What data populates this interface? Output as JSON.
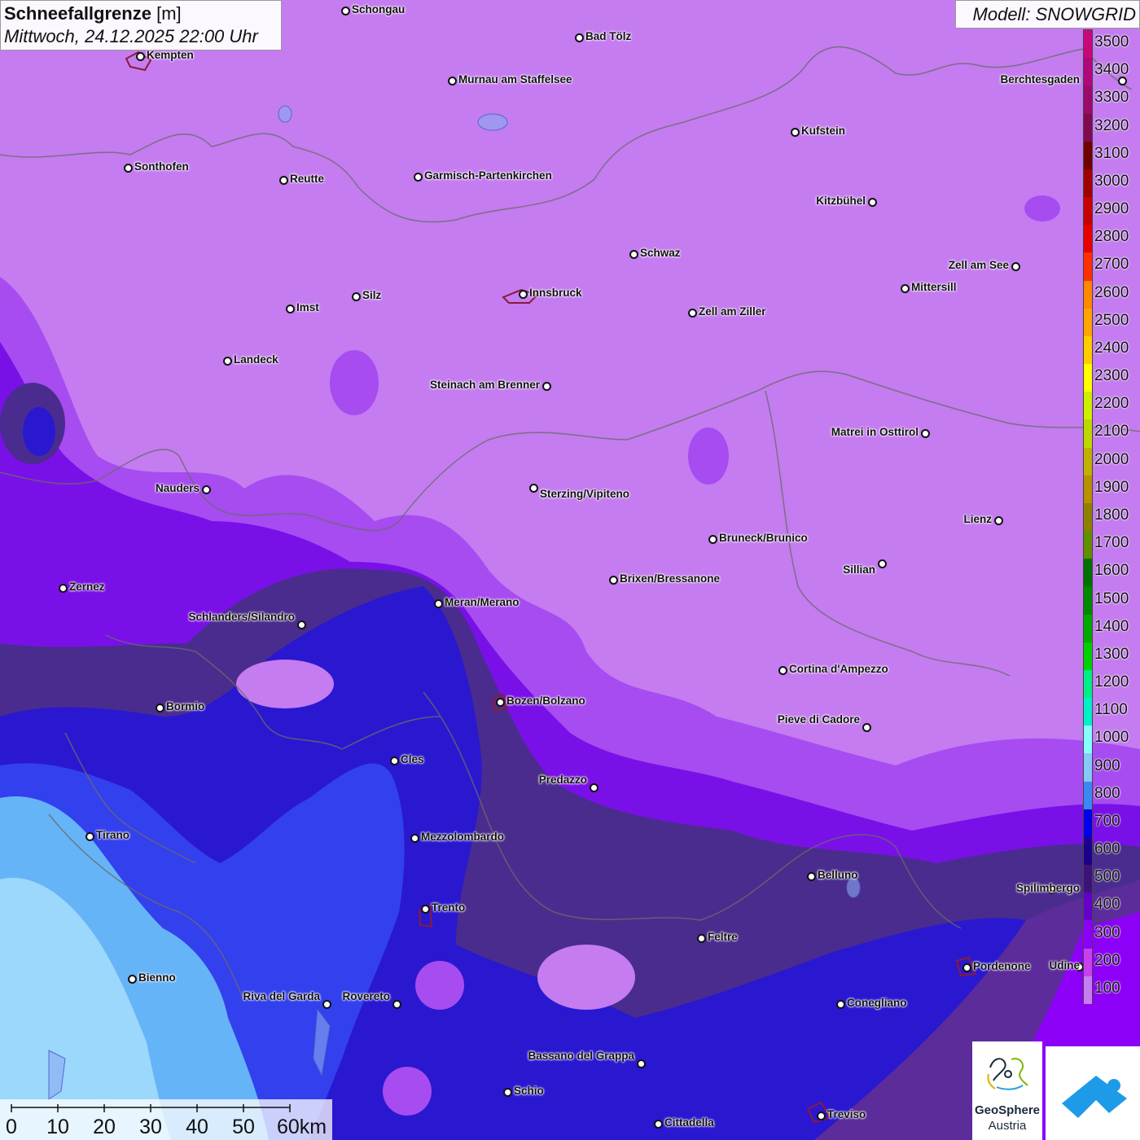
{
  "title": {
    "parameter": "Schneefallgrenze",
    "unit": "[m]",
    "datetime": "Mittwoch, 24.12.2025 22:00 Uhr"
  },
  "model": "Modell: SNOWGRID",
  "legend": {
    "labels": [
      "3500",
      "3400",
      "3300",
      "3200",
      "3100",
      "3000",
      "2900",
      "2800",
      "2700",
      "2600",
      "2500",
      "2400",
      "2300",
      "2200",
      "2100",
      "2000",
      "1900",
      "1800",
      "1700",
      "1600",
      "1500",
      "1400",
      "1300",
      "1200",
      "1100",
      "1000",
      "900",
      "800",
      "700",
      "600",
      "500",
      "400",
      "300",
      "200",
      "100"
    ],
    "colors": [
      "#c8087a",
      "#b0087a",
      "#9a0a6a",
      "#800a50",
      "#700000",
      "#a00000",
      "#c80000",
      "#e80000",
      "#ff3000",
      "#ff8800",
      "#ffa400",
      "#ffcc00",
      "#ffff00",
      "#ccf000",
      "#bcd800",
      "#c0b000",
      "#b89000",
      "#908000",
      "#609000",
      "#007000",
      "#008800",
      "#00a800",
      "#00d000",
      "#00ee88",
      "#00f0c8",
      "#88ffff",
      "#88c8f8",
      "#3c88f0",
      "#0000e8",
      "#1c008c",
      "#3c1478",
      "#6400c8",
      "#8c00f8",
      "#c840f0",
      "#c87cf4"
    ]
  },
  "cities": [
    {
      "name": "Schongau",
      "dot": [
        424,
        13
      ],
      "label_side": "right"
    },
    {
      "name": "Bad Tölz",
      "dot": [
        711,
        46
      ],
      "label_side": "right"
    },
    {
      "name": "Kempten",
      "dot": [
        172,
        69
      ],
      "label_side": "right"
    },
    {
      "name": "Murnau am Staffelsee",
      "dot": [
        555,
        99
      ],
      "label_side": "right"
    },
    {
      "name": "Berchtesgaden",
      "dot": [
        1378,
        99
      ],
      "label_side": "left"
    },
    {
      "name": "Kufstein",
      "dot": [
        976,
        162
      ],
      "label_side": "right"
    },
    {
      "name": "Sonthofen",
      "dot": [
        157,
        206
      ],
      "label_side": "right"
    },
    {
      "name": "Reutte",
      "dot": [
        348,
        221
      ],
      "label_side": "right"
    },
    {
      "name": "Garmisch-Partenkirchen",
      "dot": [
        513,
        217
      ],
      "label_side": "right"
    },
    {
      "name": "Kitzbühel",
      "dot": [
        1071,
        248
      ],
      "label_side": "left"
    },
    {
      "name": "Schwaz",
      "dot": [
        778,
        312
      ],
      "label_side": "right"
    },
    {
      "name": "Zell am See",
      "dot": [
        1247,
        327
      ],
      "label_side": "left"
    },
    {
      "name": "Innsbruck",
      "dot": [
        642,
        361
      ],
      "label_side": "right"
    },
    {
      "name": "Silz",
      "dot": [
        437,
        364
      ],
      "label_side": "right"
    },
    {
      "name": "Mittersill",
      "dot": [
        1111,
        354
      ],
      "label_side": "right"
    },
    {
      "name": "Imst",
      "dot": [
        356,
        379
      ],
      "label_side": "right"
    },
    {
      "name": "Zell am Ziller",
      "dot": [
        850,
        384
      ],
      "label_side": "right"
    },
    {
      "name": "Landeck",
      "dot": [
        279,
        443
      ],
      "label_side": "right"
    },
    {
      "name": "Steinach am Brenner",
      "dot": [
        671,
        474
      ],
      "label_side": "left"
    },
    {
      "name": "Matrei in Osttirol",
      "dot": [
        1136,
        532
      ],
      "label_side": "left"
    },
    {
      "name": "Nauders",
      "dot": [
        253,
        601
      ],
      "label_side": "left"
    },
    {
      "name": "Sterzing/Vipiteno",
      "dot": [
        655,
        599
      ],
      "label_side": "right-below"
    },
    {
      "name": "Lienz",
      "dot": [
        1226,
        639
      ],
      "label_side": "left"
    },
    {
      "name": "Bruneck/Brunico",
      "dot": [
        875,
        662
      ],
      "label_side": "right"
    },
    {
      "name": "Sillian",
      "dot": [
        1083,
        692
      ],
      "label_side": "left-below"
    },
    {
      "name": "Brixen/Bressanone",
      "dot": [
        753,
        712
      ],
      "label_side": "right"
    },
    {
      "name": "Zernez",
      "dot": [
        77,
        722
      ],
      "label_side": "right"
    },
    {
      "name": "Meran/Merano",
      "dot": [
        538,
        741
      ],
      "label_side": "right"
    },
    {
      "name": "Schlanders/Silandro",
      "dot": [
        370,
        767
      ],
      "label_side": "left-above"
    },
    {
      "name": "Cortina d'Ampezzo",
      "dot": [
        961,
        823
      ],
      "label_side": "right"
    },
    {
      "name": "Bozen/Bolzano",
      "dot": [
        614,
        862
      ],
      "label_side": "right"
    },
    {
      "name": "Bormio",
      "dot": [
        196,
        869
      ],
      "label_side": "right"
    },
    {
      "name": "Pieve di Cadore",
      "dot": [
        1064,
        893
      ],
      "label_side": "left-above"
    },
    {
      "name": "Cles",
      "dot": [
        484,
        934
      ],
      "label_side": "right"
    },
    {
      "name": "Predazzo",
      "dot": [
        729,
        967
      ],
      "label_side": "left-above"
    },
    {
      "name": "Tirano",
      "dot": [
        110,
        1027
      ],
      "label_side": "right"
    },
    {
      "name": "Mezzolombardo",
      "dot": [
        509,
        1029
      ],
      "label_side": "right"
    },
    {
      "name": "Belluno",
      "dot": [
        996,
        1076
      ],
      "label_side": "right"
    },
    {
      "name": "Spilimbergo",
      "dot": [
        1291,
        1092
      ],
      "label_side": "right"
    },
    {
      "name": "Trento",
      "dot": [
        522,
        1116
      ],
      "label_side": "right"
    },
    {
      "name": "Feltre",
      "dot": [
        861,
        1152
      ],
      "label_side": "right"
    },
    {
      "name": "Pordenone",
      "dot": [
        1187,
        1188
      ],
      "label_side": "right"
    },
    {
      "name": "Udine",
      "dot": [
        1325,
        1187
      ],
      "label_side": "right"
    },
    {
      "name": "Bienno",
      "dot": [
        162,
        1202
      ],
      "label_side": "right"
    },
    {
      "name": "Riva del Garda",
      "dot": [
        401,
        1233
      ],
      "label_side": "left-above"
    },
    {
      "name": "Rovereto",
      "dot": [
        487,
        1233
      ],
      "label_side": "left-above"
    },
    {
      "name": "Conegliano",
      "dot": [
        1032,
        1233
      ],
      "label_side": "right"
    },
    {
      "name": "Bassano del Grappa",
      "dot": [
        787,
        1306
      ],
      "label_side": "left-above"
    },
    {
      "name": "Schio",
      "dot": [
        623,
        1341
      ],
      "label_side": "right"
    },
    {
      "name": "Treviso",
      "dot": [
        1008,
        1370
      ],
      "label_side": "right"
    },
    {
      "name": "Cittadella",
      "dot": [
        808,
        1380
      ],
      "label_side": "right"
    }
  ],
  "scale": {
    "labels": [
      "0",
      "10",
      "20",
      "30",
      "40",
      "50",
      "60km"
    ]
  },
  "logos": {
    "geosphere_line1": "GeoSphere",
    "geosphere_line2": "Austria"
  }
}
